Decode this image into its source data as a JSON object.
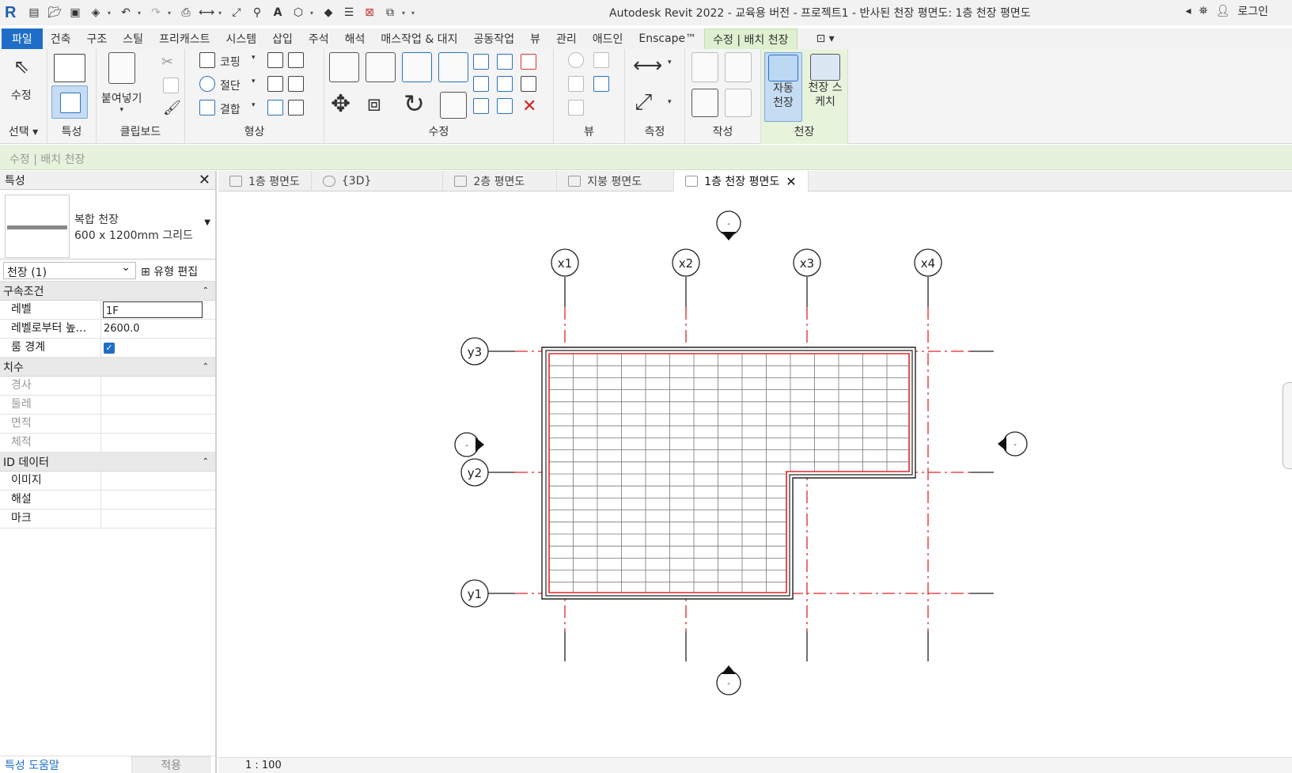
{
  "app": {
    "title": "Autodesk Revit 2022 - 교육용 버전 - 프로젝트1 - 반사된 천장 평면도: 1층 천장 평면도",
    "login_label": "로그인"
  },
  "ribbon_tabs": [
    {
      "label": "파일"
    },
    {
      "label": "건축"
    },
    {
      "label": "구조"
    },
    {
      "label": "스틸"
    },
    {
      "label": "프리캐스트"
    },
    {
      "label": "시스템"
    },
    {
      "label": "삽입"
    },
    {
      "label": "주석"
    },
    {
      "label": "해석"
    },
    {
      "label": "매스작업 & 대지"
    },
    {
      "label": "공동작업"
    },
    {
      "label": "뷰"
    },
    {
      "label": "관리"
    },
    {
      "label": "애드인"
    },
    {
      "label": "Enscape™"
    },
    {
      "label": "수정 | 배치 천장"
    }
  ],
  "ribbon": {
    "modify_label": "수정",
    "paste_label": "붙여넣기",
    "cope_label": "코핑",
    "cut_label": "절단",
    "join_label": "결합",
    "auto_ceiling_label": "자동 천장",
    "sketch_ceiling_label": "천장 스케치",
    "panels": {
      "select": "선택",
      "properties": "특성",
      "clipboard": "클립보드",
      "geometry": "형상",
      "modify": "수정",
      "view": "뷰",
      "measure": "측정",
      "create": "작성",
      "ceiling": "천장"
    }
  },
  "options_bar": {
    "text": "수정 | 배치 천장"
  },
  "properties": {
    "title": "특성",
    "type_name": "복합 천장",
    "type_sub": "600 x 1200mm 그리드",
    "instance_filter": "천장 (1)",
    "edit_type": "유형 편집",
    "groups": [
      {
        "name": "구속조건",
        "rows": [
          {
            "key": "레벨",
            "value": "1F"
          },
          {
            "key": "레벨로부터 높...",
            "value": "2600.0"
          },
          {
            "key": "룸 경계",
            "value": "✓"
          }
        ]
      },
      {
        "name": "치수",
        "rows": [
          {
            "key": "경사",
            "value": ""
          },
          {
            "key": "둘레",
            "value": ""
          },
          {
            "key": "면적",
            "value": ""
          },
          {
            "key": "체적",
            "value": ""
          }
        ]
      },
      {
        "name": "ID 데이터",
        "rows": [
          {
            "key": "이미지",
            "value": ""
          },
          {
            "key": "해설",
            "value": ""
          },
          {
            "key": "마크",
            "value": ""
          }
        ]
      }
    ],
    "help_link": "특성 도움말",
    "apply": "적용"
  },
  "view_tabs": [
    {
      "label": "1층 평면도"
    },
    {
      "label": "{3D}"
    },
    {
      "label": "2층 평면도"
    },
    {
      "label": "지붕 평면도"
    },
    {
      "label": "1층 천장 평면도"
    }
  ],
  "canvas": {
    "grid_x": [
      "x1",
      "x2",
      "x3",
      "x4"
    ],
    "grid_y": [
      "y3",
      "y2",
      "y1"
    ],
    "elevation_marker": "-",
    "scale": "1 : 100"
  },
  "colors": {
    "accent": "#1e6ec8",
    "contextual_tab": "#dff0d0",
    "grid_line": "#e0262b",
    "boundary_line": "#e0262b"
  }
}
